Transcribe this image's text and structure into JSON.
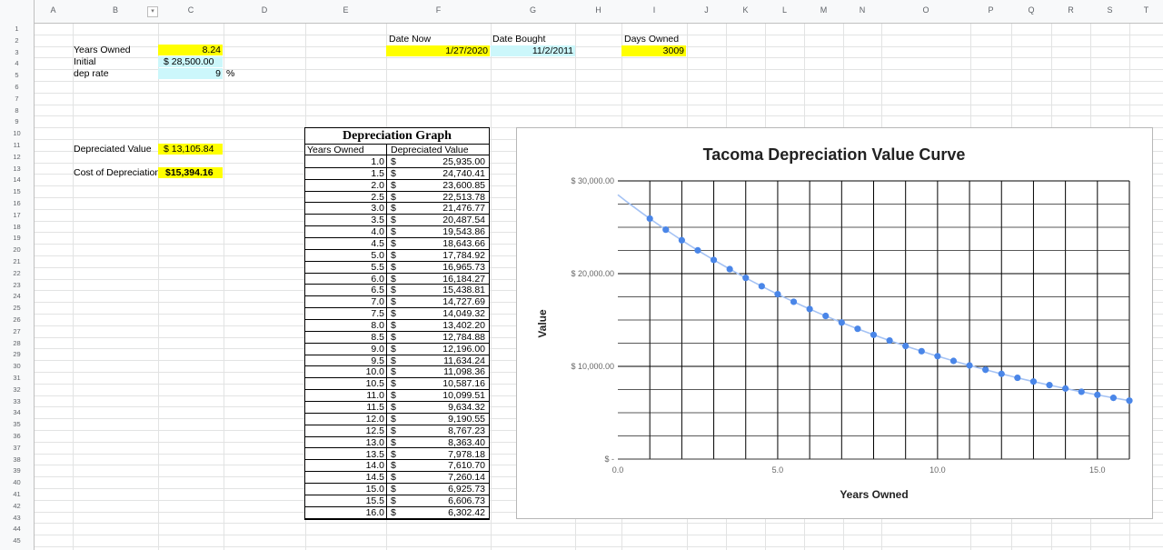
{
  "columns": [
    "A",
    "B",
    "C",
    "D",
    "E",
    "F",
    "G",
    "H",
    "I",
    "J",
    "K",
    "L",
    "M",
    "N",
    "O",
    "P",
    "Q",
    "R",
    "S",
    "T"
  ],
  "rows": [
    "1",
    "2",
    "3",
    "4",
    "5",
    "6",
    "7",
    "8",
    "9",
    "10",
    "11",
    "12",
    "13",
    "14",
    "15",
    "16",
    "17",
    "18",
    "19",
    "20",
    "21",
    "22",
    "23",
    "24",
    "25",
    "26",
    "27",
    "28",
    "29",
    "30",
    "31",
    "32",
    "33",
    "34",
    "35",
    "36",
    "37",
    "38",
    "39",
    "40",
    "41",
    "42",
    "43",
    "44",
    "45"
  ],
  "cells": {
    "years_owned_label": "Years Owned",
    "years_owned_value": "8.24",
    "initial_label": "Initial",
    "initial_value": "$  28,500.00",
    "dep_rate_label": "dep rate",
    "dep_rate_value": "9",
    "dep_rate_unit": "%",
    "date_now_label": "Date Now",
    "date_now_value": "1/27/2020",
    "date_bought_label": "Date Bought",
    "date_bought_value": "11/2/2011",
    "days_owned_label": "Days Owned",
    "days_owned_value": "3009",
    "depreciated_value_label": "Depreciated Value",
    "depreciated_value_value": "$  13,105.84",
    "cost_label": "Cost of Depreciation",
    "cost_value": "$15,394.16"
  },
  "table": {
    "title": "Depreciation Graph",
    "col1": "Years Owned",
    "col2": "Depreciated Value",
    "currency": "$",
    "rows": [
      [
        "1.0",
        "25,935.00"
      ],
      [
        "1.5",
        "24,740.41"
      ],
      [
        "2.0",
        "23,600.85"
      ],
      [
        "2.5",
        "22,513.78"
      ],
      [
        "3.0",
        "21,476.77"
      ],
      [
        "3.5",
        "20,487.54"
      ],
      [
        "4.0",
        "19,543.86"
      ],
      [
        "4.5",
        "18,643.66"
      ],
      [
        "5.0",
        "17,784.92"
      ],
      [
        "5.5",
        "16,965.73"
      ],
      [
        "6.0",
        "16,184.27"
      ],
      [
        "6.5",
        "15,438.81"
      ],
      [
        "7.0",
        "14,727.69"
      ],
      [
        "7.5",
        "14,049.32"
      ],
      [
        "8.0",
        "13,402.20"
      ],
      [
        "8.5",
        "12,784.88"
      ],
      [
        "9.0",
        "12,196.00"
      ],
      [
        "9.5",
        "11,634.24"
      ],
      [
        "10.0",
        "11,098.36"
      ],
      [
        "10.5",
        "10,587.16"
      ],
      [
        "11.0",
        "10,099.51"
      ],
      [
        "11.5",
        "9,634.32"
      ],
      [
        "12.0",
        "9,190.55"
      ],
      [
        "12.5",
        "8,767.23"
      ],
      [
        "13.0",
        "8,363.40"
      ],
      [
        "13.5",
        "7,978.18"
      ],
      [
        "14.0",
        "7,610.70"
      ],
      [
        "14.5",
        "7,260.14"
      ],
      [
        "15.0",
        "6,925.73"
      ],
      [
        "15.5",
        "6,606.73"
      ],
      [
        "16.0",
        "6,302.42"
      ]
    ]
  },
  "chart_data": {
    "type": "scatter",
    "title": "Tacoma Depreciation Value Curve",
    "xlabel": "Years Owned",
    "ylabel": "Value",
    "xlim": [
      0,
      16
    ],
    "ylim": [
      0,
      30000
    ],
    "x_ticks": [
      "0.0",
      "5.0",
      "10.0",
      "15.0"
    ],
    "y_ticks": [
      "$ -",
      "$ 10,000.00",
      "$ 20,000.00",
      "$ 30,000.00"
    ],
    "grid": true,
    "trendline": true,
    "point_color": "#4a86e8",
    "trend_color": "#a4c2f4",
    "x": [
      1.0,
      1.5,
      2.0,
      2.5,
      3.0,
      3.5,
      4.0,
      4.5,
      5.0,
      5.5,
      6.0,
      6.5,
      7.0,
      7.5,
      8.0,
      8.5,
      9.0,
      9.5,
      10.0,
      10.5,
      11.0,
      11.5,
      12.0,
      12.5,
      13.0,
      13.5,
      14.0,
      14.5,
      15.0,
      15.5,
      16.0
    ],
    "y": [
      25935.0,
      24740.41,
      23600.85,
      22513.78,
      21476.77,
      20487.54,
      19543.86,
      18643.66,
      17784.92,
      16965.73,
      16184.27,
      15438.81,
      14727.69,
      14049.32,
      13402.2,
      12784.88,
      12196.0,
      11634.24,
      11098.36,
      10587.16,
      10099.51,
      9634.32,
      9190.55,
      8767.23,
      8363.4,
      7978.18,
      7610.7,
      7260.14,
      6925.73,
      6606.73,
      6302.42
    ]
  },
  "colors": {
    "highlight_yellow": "#ffff00",
    "highlight_cyan": "#ccf7fb"
  }
}
